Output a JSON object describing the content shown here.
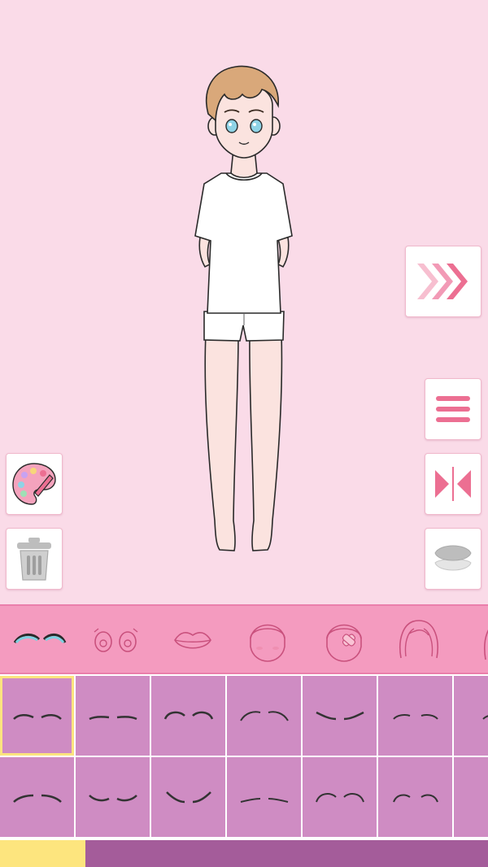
{
  "app": {
    "name": "character-dress-up"
  },
  "colors": {
    "background": "#fadbe8",
    "category_bar": "#f49bbf",
    "grid_cell": "#cf8cc3",
    "selected_outline": "#fbe47f",
    "bottom_bar": "#a45c9a",
    "accent_pink": "#ee6f93"
  },
  "side_buttons": {
    "right": [
      "next-arrows-icon",
      "menu-icon",
      "flip-icon",
      "layers-icon"
    ],
    "left": [
      "palette-icon",
      "trash-icon"
    ]
  },
  "categories": [
    {
      "name": "eyebrows",
      "icon": "eyebrows-icon",
      "selected": true
    },
    {
      "name": "eyes",
      "icon": "eyes-icon"
    },
    {
      "name": "mouth",
      "icon": "lips-icon"
    },
    {
      "name": "blush",
      "icon": "blush-face-icon"
    },
    {
      "name": "bandage",
      "icon": "bandage-face-icon"
    },
    {
      "name": "hair",
      "icon": "hair-icon"
    },
    {
      "name": "hair-2",
      "icon": "hair-side-icon"
    }
  ],
  "eyebrow_options": {
    "rows": 2,
    "columns_visible": 7,
    "selected_index": 0
  },
  "pagination": {
    "current_page": 1
  }
}
